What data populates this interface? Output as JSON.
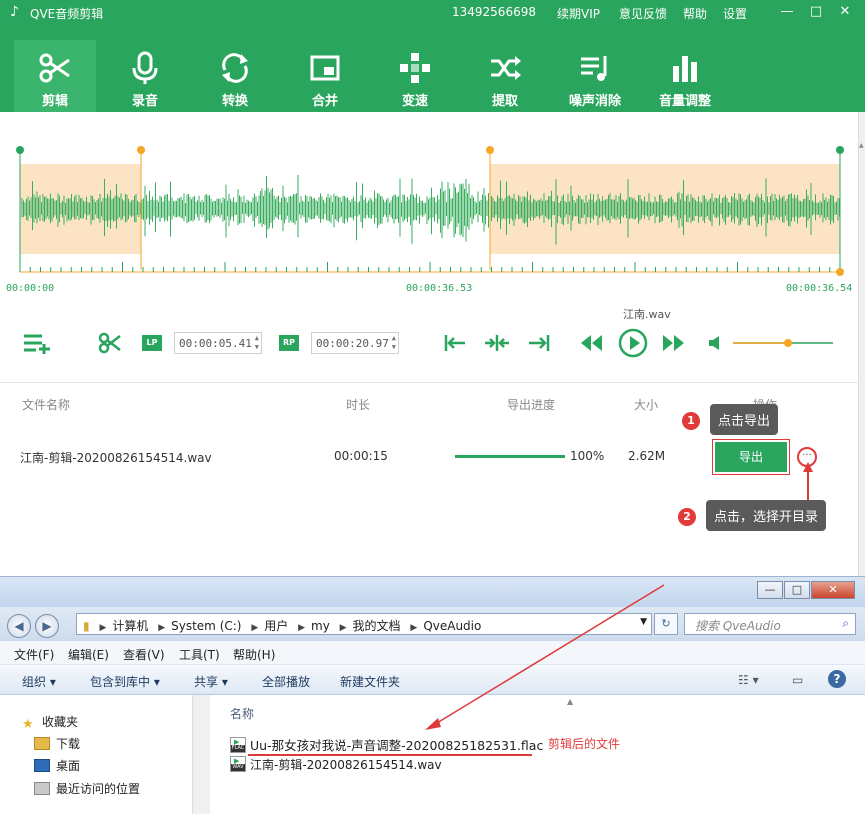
{
  "app": {
    "title": "QVE音频剪辑",
    "phone": "13492566698",
    "menu": [
      "续期VIP",
      "意见反馈",
      "帮助",
      "设置"
    ],
    "window_buttons": [
      "—",
      "□",
      "✕"
    ],
    "accent_color": "#2aa55e"
  },
  "toolbar": {
    "items": [
      {
        "label": "剪辑",
        "icon": "scissors-icon"
      },
      {
        "label": "录音",
        "icon": "microphone-icon"
      },
      {
        "label": "转换",
        "icon": "convert-icon"
      },
      {
        "label": "合并",
        "icon": "merge-icon"
      },
      {
        "label": "变速",
        "icon": "speed-icon"
      },
      {
        "label": "提取",
        "icon": "extract-icon"
      },
      {
        "label": "噪声消除",
        "icon": "noise-icon"
      },
      {
        "label": "音量调整",
        "icon": "volume-bars-icon"
      }
    ],
    "active_index": 0
  },
  "waveform": {
    "start_time": "00:00:00",
    "mid_time": "00:00:36.53",
    "end_time": "00:00:36.54"
  },
  "controls": {
    "lp_tag": "LP",
    "rp_tag": "RP",
    "lp_value": "00:00:05.41",
    "rp_value": "00:00:20.97",
    "current_file": "江南.wav",
    "volume_level": 0.55
  },
  "file_list": {
    "headers": [
      "文件名称",
      "时长",
      "导出进度",
      "大小",
      "操作"
    ],
    "rows": [
      {
        "name": "江南-剪辑-20200826154514.wav",
        "duration": "00:00:15",
        "progress": "100%",
        "progress_value": 1.0,
        "size": "2.62M",
        "action": "导出"
      }
    ]
  },
  "tips": {
    "tip1_num": "1",
    "tip1": "点击导出",
    "tip2_num": "2",
    "tip2": "点击，选择开目录"
  },
  "explorer": {
    "breadcrumb": [
      "计算机",
      "System (C:)",
      "用户",
      "my",
      "我的文档",
      "QveAudio"
    ],
    "search_placeholder": "搜索 QveAudio",
    "menu": [
      "文件(F)",
      "编辑(E)",
      "查看(V)",
      "工具(T)",
      "帮助(H)"
    ],
    "commands": [
      "组织 ▾",
      "包含到库中 ▾",
      "共享 ▾",
      "全部播放",
      "新建文件夹"
    ],
    "nav": [
      "收藏夹",
      "下载",
      "桌面",
      "最近访问的位置"
    ],
    "column_name": "名称",
    "files": [
      {
        "name": "Uu-那女孩对我说-声音调整-20200825182531.flac",
        "type": "FLAC"
      },
      {
        "name": "江南-剪辑-20200826154514.wav",
        "type": "WAV"
      }
    ],
    "annotation": "剪辑后的文件"
  }
}
